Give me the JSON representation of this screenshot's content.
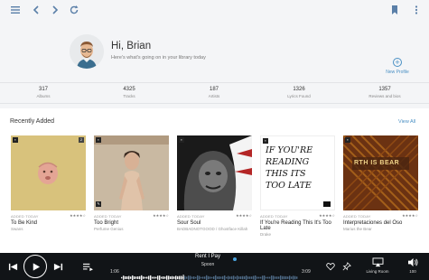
{
  "greeting": "Hi, Brian",
  "subtitle": "Here's what's going on in your library today",
  "new_profile": "New Profile",
  "stats": [
    {
      "value": "317",
      "label": "Albums"
    },
    {
      "value": "4325",
      "label": "Tracks"
    },
    {
      "value": "187",
      "label": "Artists"
    },
    {
      "value": "1326",
      "label": "Lyrics Found"
    },
    {
      "value": "1357",
      "label": "Reviews and bios"
    }
  ],
  "recent": {
    "title": "Recently Added",
    "view_all": "View All",
    "albums": [
      {
        "added": "ADDED TODAY",
        "title": "To Be Kind",
        "artist": "Swans",
        "rating": "★★★★☆"
      },
      {
        "added": "ADDED TODAY",
        "title": "Too Bright",
        "artist": "Perfume Genius",
        "rating": "★★★★☆"
      },
      {
        "added": "ADDED TODAY",
        "title": "Sour Soul",
        "artist": "BADBADNOTGOOD / Ghostface Killah",
        "rating": "★★★★☆"
      },
      {
        "added": "ADDED TODAY",
        "title": "If You're Reading This It's Too Late",
        "artist": "Drake",
        "rating": "★★★★☆"
      },
      {
        "added": "ADDED TODAY",
        "title": "Interpretaciones del Oso",
        "artist": "Marius the Bear",
        "rating": "★★★★☆"
      }
    ],
    "cover_art_text": {
      "drake_lines": [
        "IF YOU'RE",
        "READING",
        "THIS ITS",
        "TOO LATE"
      ],
      "bear_text": "RTH IS BEAR"
    }
  },
  "player": {
    "song": "Rent I Pay",
    "artist": "Spoon",
    "current_time": "1:06",
    "total_time": "3:09",
    "progress": 0.35,
    "device_label": "Living Room",
    "volume": "100"
  }
}
